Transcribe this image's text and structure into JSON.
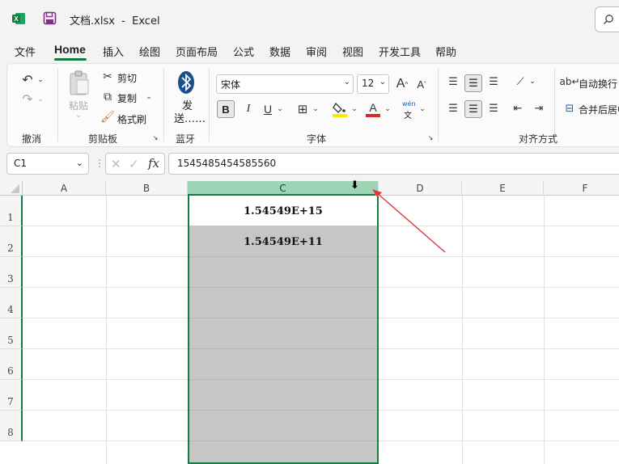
{
  "window": {
    "title": "文档.xlsx  -  Excel"
  },
  "tabs": [
    "文件",
    "Home",
    "插入",
    "绘图",
    "页面布局",
    "公式",
    "数据",
    "审阅",
    "视图",
    "开发工具",
    "帮助"
  ],
  "ribbon": {
    "undo_group": "撤消",
    "clipboard": {
      "paste": "粘贴",
      "cut": "剪切",
      "copy": "复制",
      "format_painter": "格式刷",
      "group": "剪贴板"
    },
    "bluetooth": {
      "send_line1": "发",
      "send_line2": "送……",
      "group": "蓝牙"
    },
    "font": {
      "name": "宋体",
      "size": "12",
      "bold": "B",
      "italic": "I",
      "underline": "U",
      "group": "字体",
      "phonetic_top": "wén",
      "phonetic_bottom": "文"
    },
    "alignment": {
      "wrap_text": "自动换行",
      "merge_center": "合并后居中",
      "group": "对齐方式"
    }
  },
  "formula_bar": {
    "name_box": "C1",
    "formula": "1545485454585560",
    "fx": "fx"
  },
  "grid": {
    "columns": [
      "A",
      "B",
      "C",
      "D",
      "E",
      "F"
    ],
    "rows": [
      "1",
      "2",
      "3",
      "4",
      "5",
      "6",
      "7",
      "8"
    ],
    "cells": {
      "C1": "1.54549E+15",
      "C2": "1.54549E+11"
    },
    "selected_column": "C",
    "accent_color": "#107c41",
    "annotation_arrow_color": "#e0393e"
  }
}
